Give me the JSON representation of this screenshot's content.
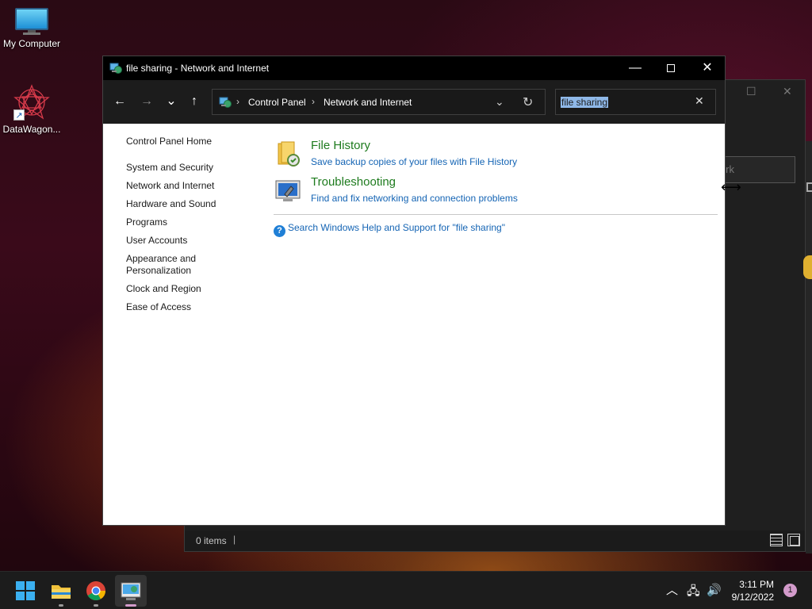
{
  "desktop": {
    "icons": [
      {
        "label": "My Computer",
        "icon": "monitor-icon"
      },
      {
        "label": "DataWagon...",
        "icon": "datawagon-logo-icon"
      }
    ]
  },
  "background_window": {
    "search_partial": "rk",
    "status_items": "0 items",
    "status_sep": "|"
  },
  "window": {
    "title": "file sharing - Network and Internet",
    "controls": {
      "minimize": "—",
      "close": "✕"
    },
    "nav": {
      "back": "←",
      "forward": "→",
      "recent": "⌄",
      "up": "↑"
    },
    "address": {
      "crumbs": [
        "Control Panel",
        "Network and Internet"
      ],
      "separator": "›",
      "dropdown": "⌄",
      "refresh": "↻"
    },
    "search": {
      "value": "file sharing",
      "clear": "✕"
    },
    "sidebar": {
      "home": "Control Panel Home",
      "items": [
        "System and Security",
        "Network and Internet",
        "Hardware and Sound",
        "Programs",
        "User Accounts",
        "Appearance and Personalization",
        "Clock and Region",
        "Ease of Access"
      ]
    },
    "results": [
      {
        "title": "File History",
        "subtitle": "Save backup copies of your files with File History",
        "icon": "file-history-icon"
      },
      {
        "title": "Troubleshooting",
        "subtitle": "Find and fix networking and connection problems",
        "icon": "troubleshooting-icon"
      }
    ],
    "help_link": "Search Windows Help and Support for \"file sharing\""
  },
  "taskbar": {
    "apps": [
      "start-icon",
      "file-explorer-icon",
      "chrome-icon",
      "control-panel-icon"
    ],
    "tray": {
      "chevron": "︿",
      "network": "🖧",
      "volume": "🔊"
    },
    "time": "3:11 PM",
    "date": "9/12/2022",
    "notifications": "1"
  },
  "colors": {
    "link_blue": "#1464b4",
    "title_green": "#1e7b1e",
    "titlebar": "#000000",
    "navbar": "#1c1c1c",
    "taskbar": "#1c1c1c",
    "selection": "#8fb8e8"
  }
}
